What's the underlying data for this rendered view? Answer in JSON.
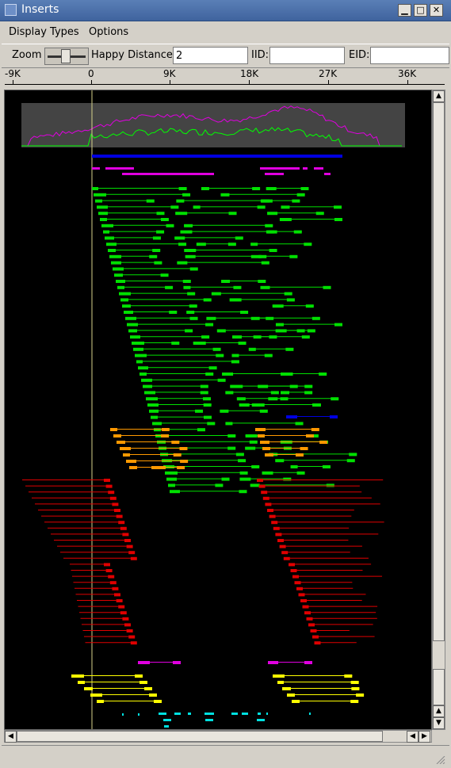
{
  "window": {
    "title": "Inserts",
    "controls": {
      "minimize": "▁",
      "maximize": "□",
      "close": "✕"
    }
  },
  "menu": {
    "items": [
      {
        "label": "Display Types",
        "mnemonic": "D"
      },
      {
        "label": "Options",
        "mnemonic": "O"
      }
    ]
  },
  "toolbar": {
    "zoom_label": "Zoom",
    "happy_distance_label": "Happy Distance:",
    "happy_distance_value": "2",
    "iid_label": "IID:",
    "iid_value": "",
    "eid_label": "EID:",
    "eid_value": ""
  },
  "ruler": {
    "ticks": [
      "-9K",
      "0",
      "9K",
      "18K",
      "27K",
      "36K"
    ]
  },
  "colors": {
    "happy": "#00e000",
    "blue": "#0000e0",
    "magenta": "#e000e0",
    "orange": "#ff9900",
    "red": "#e00000",
    "yellow": "#ffff00",
    "cyan": "#00e0e0",
    "overview_bg": "#444444"
  }
}
